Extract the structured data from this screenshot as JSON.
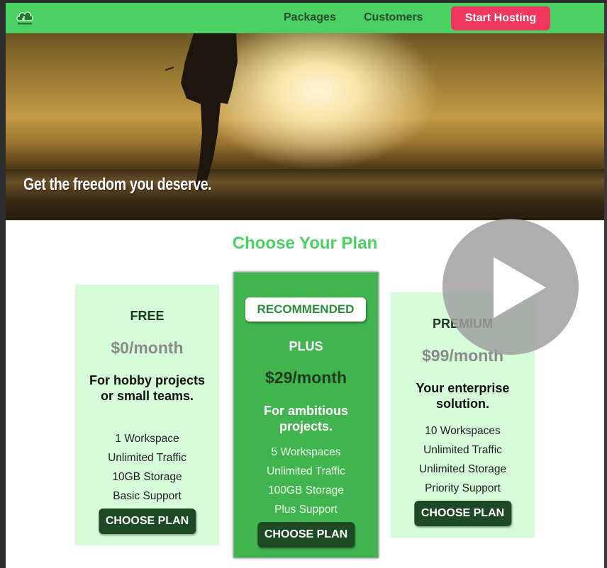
{
  "header": {
    "logo_icon": "cloud-hosting-logo-icon",
    "nav": [
      "Packages",
      "Customers"
    ],
    "cta_label": "Start Hosting",
    "colors": {
      "header_bg": "#4bd064",
      "cta_bg": "#f1375d"
    }
  },
  "hero": {
    "tagline": "Get the freedom you deserve."
  },
  "plans_section": {
    "title": "Choose Your Plan",
    "plans": [
      {
        "name": "FREE",
        "price": "$0/month",
        "description": "For hobby projects or small teams.",
        "features": [
          "1 Workspace",
          "Unlimited Traffic",
          "10GB Storage",
          "Basic Support"
        ],
        "button": "CHOOSE PLAN"
      },
      {
        "badge": "RECOMMENDED",
        "name": "PLUS",
        "price": "$29/month",
        "description": "For ambitious projects.",
        "features": [
          "5 Workspaces",
          "Unlimited Traffic",
          "100GB Storage",
          "Plus Support"
        ],
        "button": "CHOOSE PLAN"
      },
      {
        "name": "PREMIUM",
        "price": "$99/month",
        "description": "Your enterprise solution.",
        "features": [
          "10 Workspaces",
          "Unlimited Traffic",
          "Unlimited Storage",
          "Priority Support"
        ],
        "button": "CHOOSE PLAN"
      }
    ]
  },
  "overlay": {
    "icon": "play-icon"
  }
}
